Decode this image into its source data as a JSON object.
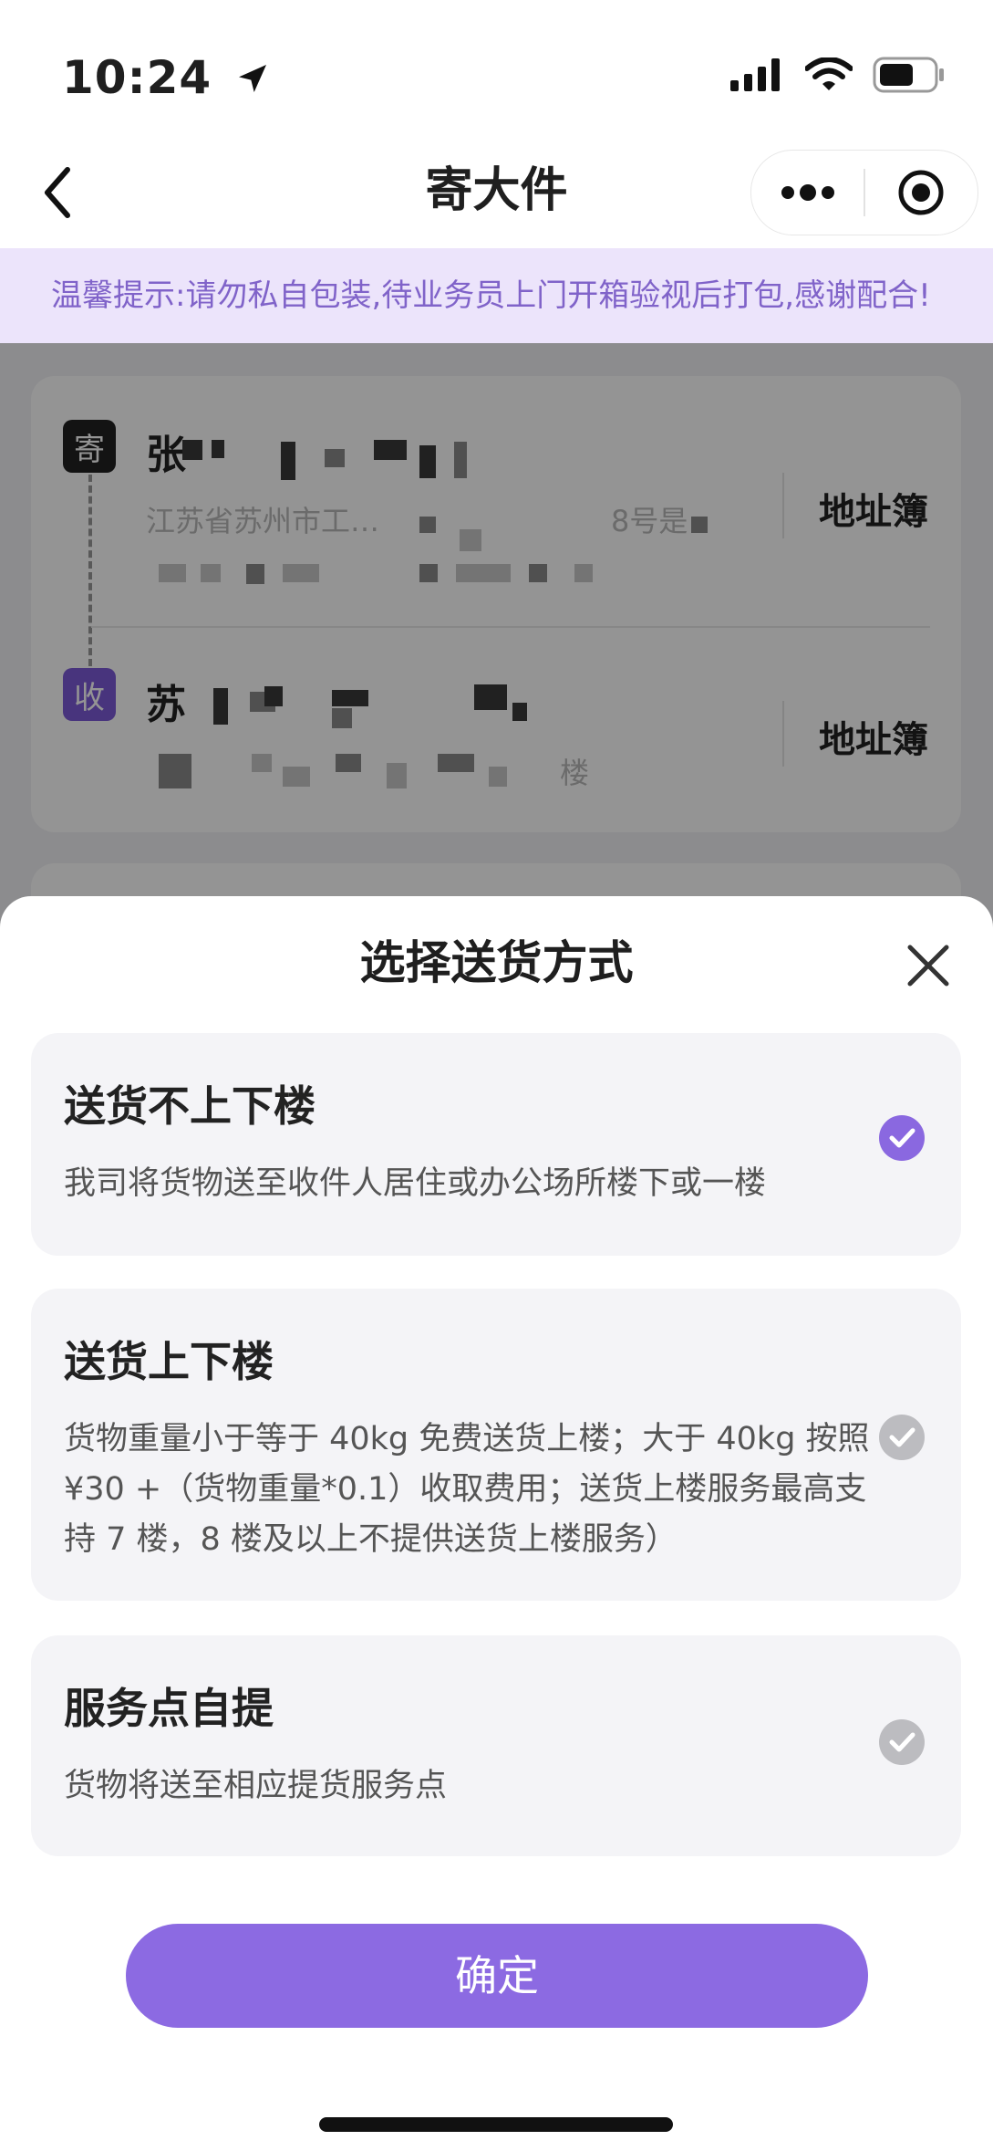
{
  "status_bar": {
    "time": "10:24"
  },
  "nav": {
    "title": "寄大件"
  },
  "tip": {
    "text": "温馨提示:请勿私自包装,待业务员上门开箱验视后打包,感谢配合!"
  },
  "sender": {
    "tag": "寄",
    "name_visible": "张",
    "address_fragment": "江苏省苏州市工…",
    "address_fragment2": "8号是",
    "book_label": "地址簿"
  },
  "receiver": {
    "tag": "收",
    "name_visible": "苏",
    "address_fragment": "楼",
    "book_label": "地址簿"
  },
  "sheet": {
    "title": "选择送货方式",
    "options": [
      {
        "title": "送货不上下楼",
        "desc": "我司将货物送至收件人居住或办公场所楼下或一楼",
        "selected": true
      },
      {
        "title": "送货上下楼",
        "desc": "货物重量小于等于 40kg 免费送货上楼；大于 40kg 按照 ¥30 +（货物重量*0.1）收取费用；送货上楼服务最高支持 7 楼，8 楼及以上不提供送货上楼服务）",
        "selected": false
      },
      {
        "title": "服务点自提",
        "desc": "货物将送至相应提货服务点",
        "selected": false
      }
    ],
    "confirm_label": "确定"
  },
  "colors": {
    "accent": "#8c6ae2",
    "tip_bg": "#ece4fb",
    "tip_text": "#8063c9"
  },
  "icons": [
    "location-arrow-icon",
    "signal-icon",
    "wifi-icon",
    "battery-icon",
    "back-chevron-icon",
    "more-dots-icon",
    "target-icon",
    "close-icon",
    "check-icon"
  ]
}
